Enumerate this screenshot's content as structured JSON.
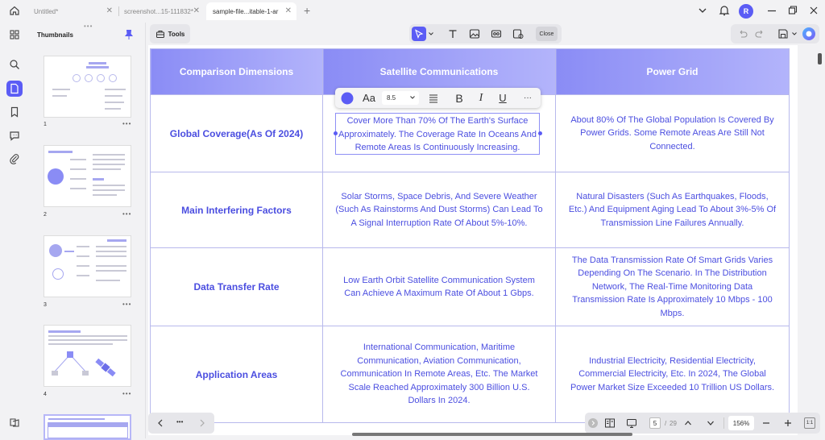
{
  "tabs": [
    {
      "label": "Untitled*",
      "active": false
    },
    {
      "label": "screenshot...15-111832*",
      "active": false
    },
    {
      "label": "sample-file...itable-1-ar",
      "active": true
    }
  ],
  "user": {
    "avatar_letter": "R"
  },
  "sidebar": {
    "panel_title": "Thumbnails",
    "pages": [
      "1",
      "2",
      "3",
      "4"
    ]
  },
  "toolbar": {
    "tools_label": "Tools",
    "close_label": "Close"
  },
  "format_bar": {
    "font_size": "8.5",
    "font_icon_label": "Aa",
    "bold": "B",
    "italic": "I",
    "underline": "U",
    "more": "···",
    "text_color": "#4b4ee0"
  },
  "table": {
    "headers": [
      "Comparison Dimensions",
      "Satellite Communications",
      "Power Grid"
    ],
    "rows": [
      {
        "dimension": "Global Coverage(As Of 2024)",
        "satellite": "Cover More Than 70% Of The Earth's Surface Approximately. The Coverage Rate In Oceans And Remote Areas Is Continuously Increasing.",
        "grid": "About 80% Of The Global Population Is Covered By Power Grids. Some Remote Areas Are Still Not Connected."
      },
      {
        "dimension": "Main Interfering Factors",
        "satellite": "Solar Storms, Space Debris, And Severe Weather (Such As Rainstorms And Dust Storms) Can Lead To A Signal Interruption Rate Of About 5%-10%.",
        "grid": "Natural Disasters (Such As Earthquakes, Floods, Etc.) And Equipment Aging Lead To About 3%-5% Of Transmission Line Failures Annually."
      },
      {
        "dimension": "Data Transfer Rate",
        "satellite": "Low Earth Orbit Satellite Communication System Can Achieve A Maximum Rate Of About 1 Gbps.",
        "grid": "The Data Transmission Rate Of Smart Grids Varies Depending On The Scenario. In The Distribution Network, The Real-Time Monitoring Data Transmission Rate Is Approximately 10 Mbps - 100 Mbps."
      },
      {
        "dimension": "Application Areas",
        "satellite": "International Communication, Maritime Communication, Aviation Communication, Communication In Remote Areas, Etc. The Market Scale Reached Approximately 300 Billion U.S. Dollars In 2024.",
        "grid": "Industrial Electricity, Residential Electricity, Commercial Electricity, Etc. In 2024, The Global Power Market Size Exceeded 10 Trillion US Dollars."
      }
    ]
  },
  "page_nav": {
    "current": "5",
    "separator": "/",
    "total": "29"
  },
  "zoom": {
    "level": "156%",
    "fit_label": "1:1"
  },
  "colors": {
    "accent": "#5b5cf5",
    "header_start": "#8a8cf5",
    "header_end": "#b3b4fb",
    "table_text": "#4b4ee0"
  }
}
